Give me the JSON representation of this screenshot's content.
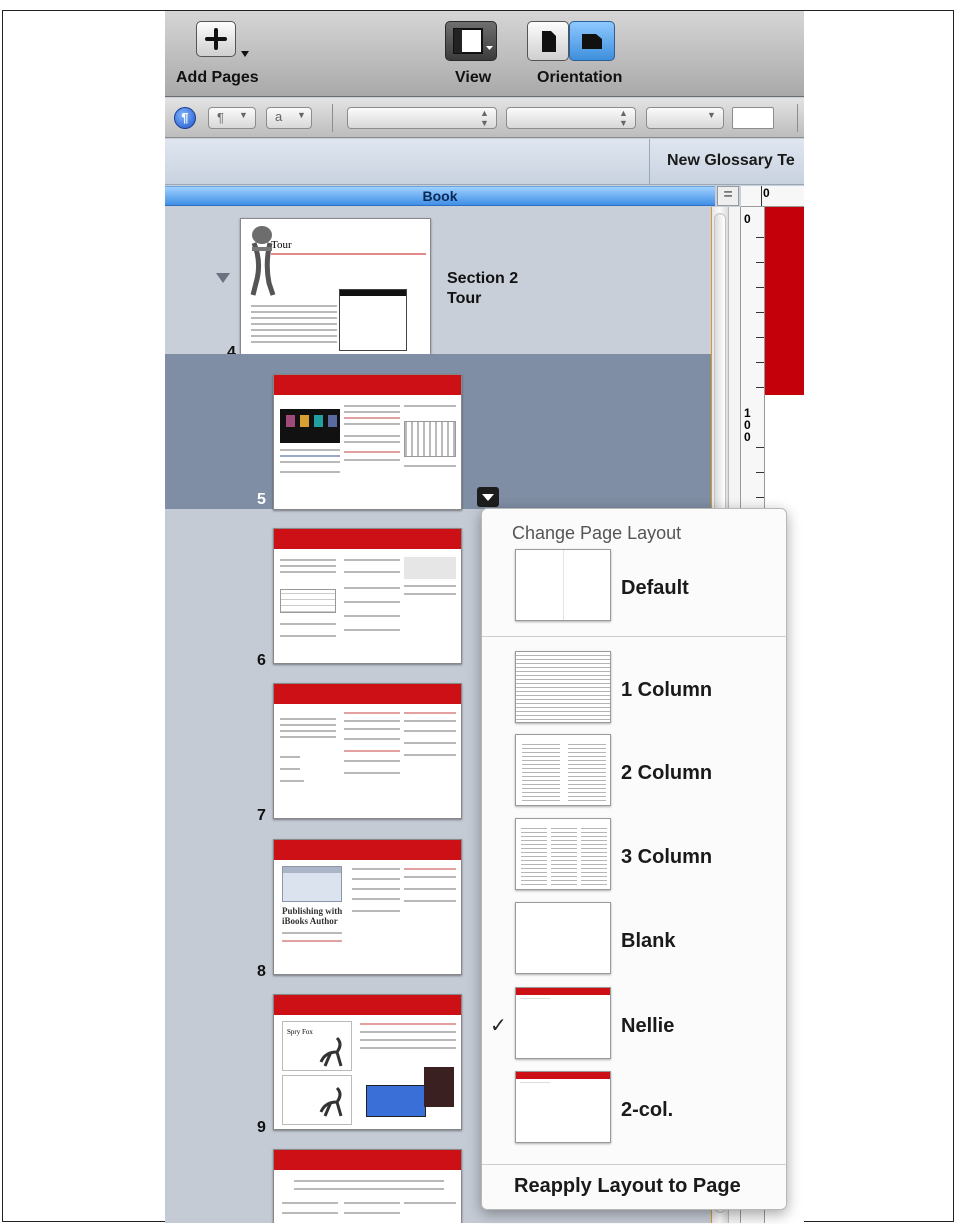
{
  "toolbar": {
    "add_pages_label": "Add Pages",
    "view_label": "View",
    "orientation_label": "Orientation"
  },
  "format_bar": {
    "paragraph_style": "¶",
    "char_style": "a"
  },
  "glossary_bar": {
    "new_term_label": "New Glossary Te"
  },
  "book_panel": {
    "header": "Book",
    "section": {
      "title": "Section 2",
      "subtitle": "Tour",
      "thumb_title": "Tour"
    },
    "pages": [
      "4",
      "5",
      "6",
      "7",
      "8",
      "9"
    ],
    "page8_heading": "Publishing with iBooks Author",
    "page9_heading": "Spry Fox"
  },
  "rulers": {
    "h_zero": "0",
    "v_zero": "0",
    "v_100": "1\n0\n0"
  },
  "layout_menu": {
    "title": "Change Page Layout",
    "items": [
      {
        "label": "Default",
        "checked": false
      },
      {
        "label": "1 Column",
        "checked": false
      },
      {
        "label": "2 Column",
        "checked": false
      },
      {
        "label": "3 Column",
        "checked": false
      },
      {
        "label": "Blank",
        "checked": false
      },
      {
        "label": "Nellie",
        "checked": true
      },
      {
        "label": "2-col.",
        "checked": false
      }
    ],
    "check_mark": "✓",
    "reapply_label": "Reapply Layout to Page"
  },
  "colors": {
    "accent_red": "#cc1016",
    "selection_blue": "#7f8ea4",
    "header_blue": "#3f8fe6"
  }
}
